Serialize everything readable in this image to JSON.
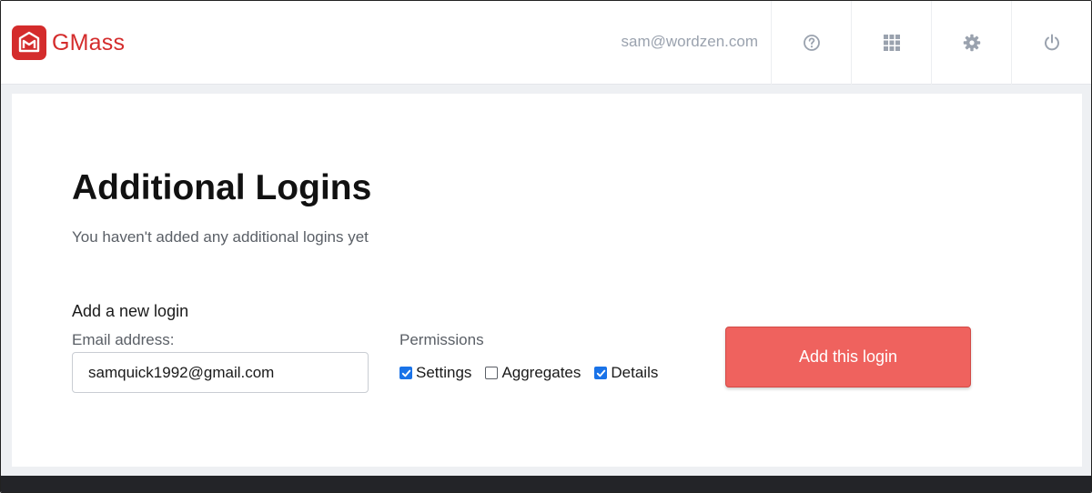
{
  "app": {
    "name": "GMass",
    "brand_color": "#d42c2c"
  },
  "header": {
    "user_email": "sam@wordzen.com",
    "buttons": [
      {
        "icon": "help-icon"
      },
      {
        "icon": "apps-grid-icon"
      },
      {
        "icon": "gear-icon"
      },
      {
        "icon": "power-icon"
      }
    ]
  },
  "main": {
    "title": "Additional Logins",
    "subtitle": "You haven't added any additional logins yet",
    "form": {
      "section_label": "Add a new login",
      "email_label": "Email address:",
      "email_value": "samquick1992@gmail.com",
      "permissions_label": "Permissions",
      "permissions": [
        {
          "label": "Settings",
          "checked": true
        },
        {
          "label": "Aggregates",
          "checked": false
        },
        {
          "label": "Details",
          "checked": true
        }
      ],
      "submit_label": "Add this login",
      "submit_color": "#ef625e"
    }
  }
}
